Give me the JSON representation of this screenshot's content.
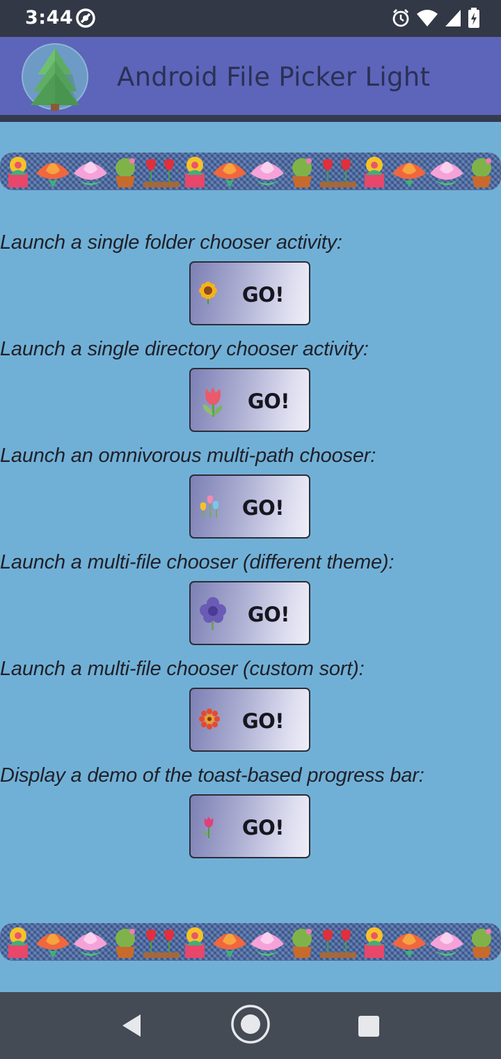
{
  "status_bar": {
    "time": "3:44",
    "icons": [
      "dnd-icon",
      "alarm-icon",
      "wifi-icon",
      "signal-icon",
      "battery-charging-icon"
    ]
  },
  "app_bar": {
    "title": "Android File Picker Light",
    "logo_icon": "pine-tree-icon",
    "color": "#5c65b9"
  },
  "rows": [
    {
      "label": "Launch a single folder chooser activity:",
      "button": "GO!",
      "icon": "sunflower-icon"
    },
    {
      "label": "Launch a single directory chooser activity:",
      "button": "GO!",
      "icon": "tulip-icon"
    },
    {
      "label": "Launch an omnivorous multi-path chooser:",
      "button": "GO!",
      "icon": "tulips-bouquet-icon"
    },
    {
      "label": "Launch a multi-file chooser (different theme):",
      "button": "GO!",
      "icon": "violet-flower-icon"
    },
    {
      "label": "Launch a multi-file chooser (custom sort):",
      "button": "GO!",
      "icon": "gerbera-icon"
    },
    {
      "label": "Display a demo of the toast-based progress bar:",
      "button": "GO!",
      "icon": "small-tulip-icon"
    }
  ],
  "nav_bar": {
    "back": "back-icon",
    "home": "home-icon",
    "recents": "recents-icon"
  },
  "colors": {
    "background": "#71b0d6",
    "status_bar": "#333846",
    "nav_bar": "#444b55"
  }
}
